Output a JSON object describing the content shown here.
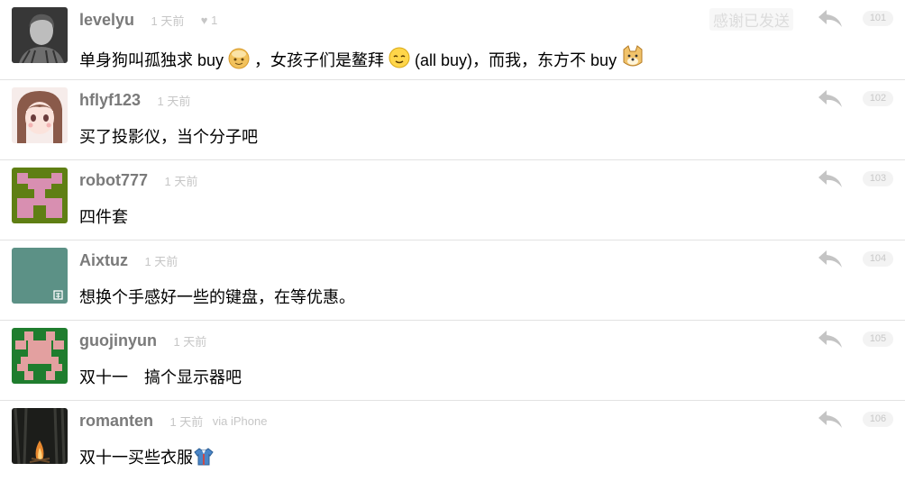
{
  "comments": [
    {
      "username": "levelyu",
      "time": "1 天前",
      "likes": "♥ 1",
      "thanks": "感谢已发送",
      "floor": "101",
      "parts": [
        "单身狗叫孤独求 buy",
        "，女孩子们是鳌拜",
        "(all buy)，而我，东方不 buy"
      ]
    },
    {
      "username": "hflyf123",
      "time": "1 天前",
      "floor": "102",
      "text": "买了投影仪，当个分子吧"
    },
    {
      "username": "robot777",
      "time": "1 天前",
      "floor": "103",
      "text": "四件套"
    },
    {
      "username": "Aixtuz",
      "time": "1 天前",
      "floor": "104",
      "text": "想换个手感好一些的键盘，在等优惠。"
    },
    {
      "username": "guojinyun",
      "time": "1 天前",
      "floor": "105",
      "text": "双十一　搞个显示器吧"
    },
    {
      "username": "romanten",
      "time": "1 天前",
      "via": "via iPhone",
      "floor": "106",
      "text": "双十一买些衣服"
    }
  ],
  "icons": {
    "reply": "reply-arrow-icon",
    "emoji_1": "pie-face-emoji-icon",
    "emoji_2": "relieved-face-emoji-icon",
    "emoji_3": "doge-emoji-icon",
    "emoji_4": "shirt-emoji-icon"
  },
  "colors": {
    "username": "#7a7a7a",
    "meta": "#c6c6c6",
    "divider": "#e2e2e2",
    "identicon_robot": "#d88fb1",
    "identicon_robot_bg": "#5f7f14",
    "identicon_guo": "#e3a0a0",
    "identicon_guo_bg": "#1f7d2e",
    "avatar_aixtuz": "#5c9186"
  }
}
